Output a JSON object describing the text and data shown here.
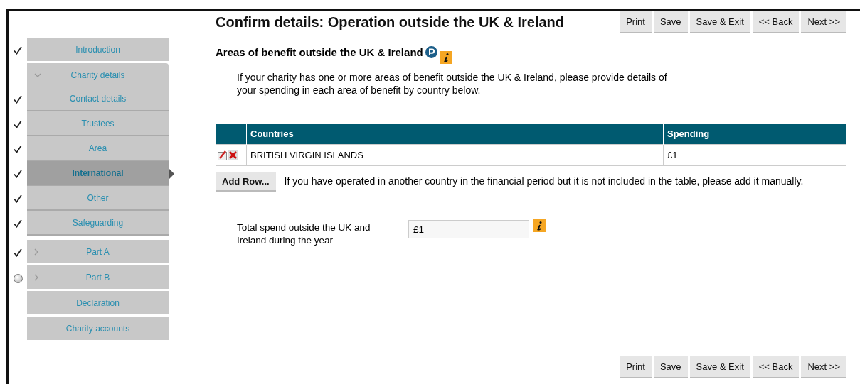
{
  "title": "Confirm details: Operation outside the UK & Ireland",
  "top_buttons": [
    "Print",
    "Save",
    "Save & Exit",
    "<< Back",
    "Next >>"
  ],
  "sidebar": {
    "items": [
      {
        "label": "Introduction",
        "complete": true,
        "in_progress": false,
        "selected": false
      },
      {
        "label": "Charity details",
        "complete": false,
        "in_progress": false,
        "selected": false,
        "expanded": true,
        "children": [
          {
            "label": "Contact details",
            "complete": true,
            "in_progress": false,
            "selected": false
          },
          {
            "label": "Trustees",
            "complete": true,
            "in_progress": false,
            "selected": false
          },
          {
            "label": "Area",
            "complete": true,
            "in_progress": false,
            "selected": false
          },
          {
            "label": "International",
            "complete": true,
            "in_progress": false,
            "selected": true
          },
          {
            "label": "Other",
            "complete": true,
            "in_progress": false,
            "selected": false
          },
          {
            "label": "Safeguarding",
            "complete": true,
            "in_progress": false,
            "selected": false
          }
        ]
      },
      {
        "label": "Part A",
        "complete": true,
        "in_progress": false,
        "selected": false,
        "expanded": false
      },
      {
        "label": "Part B",
        "complete": false,
        "in_progress": true,
        "selected": false,
        "expanded": false
      },
      {
        "label": "Declaration",
        "complete": false,
        "in_progress": false,
        "selected": false
      },
      {
        "label": "Charity accounts",
        "complete": false,
        "in_progress": false,
        "selected": false
      }
    ]
  },
  "section": {
    "heading": "Areas of benefit outside the UK & Ireland",
    "intro": "If your charity has one or more areas of benefit outside the UK & Ireland, please provide details of your spending in each area of benefit by country below."
  },
  "table": {
    "columns": [
      "Countries",
      "Spending"
    ],
    "rows": [
      {
        "country": "BRITISH VIRGIN ISLANDS",
        "spending": "£1"
      }
    ]
  },
  "add_row": {
    "button": "Add Row...",
    "note": "If you have operated in another country in the financial period but it is not included in the table, please add it manually."
  },
  "total": {
    "label": "Total spend outside the UK and Ireland during the year",
    "value": "£1"
  },
  "bottom_buttons": [
    "Print",
    "Save",
    "Save & Exit",
    "<< Back",
    "Next >>"
  ]
}
